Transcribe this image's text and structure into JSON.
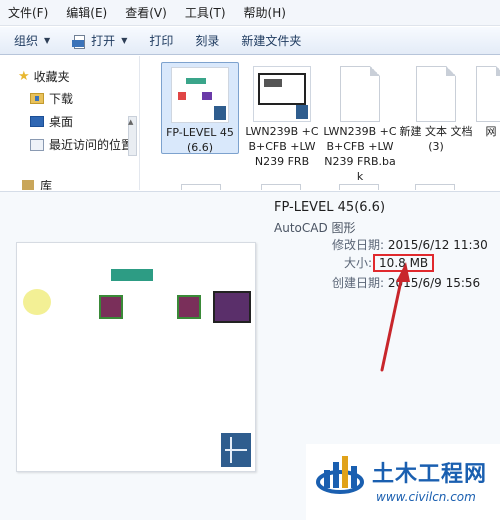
{
  "menubar": {
    "items": [
      "文件(F)",
      "编辑(E)",
      "查看(V)",
      "工具(T)",
      "帮助(H)"
    ]
  },
  "toolbar": {
    "organize": "组织",
    "open": "打开",
    "print": "打印",
    "burn": "刻录",
    "new_folder": "新建文件夹"
  },
  "nav": {
    "favorites": "收藏夹",
    "downloads": "下载",
    "desktop": "桌面",
    "recent": "最近访问的位置",
    "libraries": "库"
  },
  "files": [
    {
      "name": "FP-LEVEL 45(6.6)",
      "icon": "dwg-file-icon",
      "selected": true
    },
    {
      "name": "LWN239B +CB+CFB +LWN239 FRB",
      "icon": "dwg-file-icon"
    },
    {
      "name": "LWN239B +CB+CFB +LWN239 FRB.bak",
      "icon": "blank-file-icon"
    },
    {
      "name": "新建 文本 文档 (3)",
      "icon": "text-file-icon"
    },
    {
      "name": "网",
      "icon": "blank-file-icon"
    }
  ],
  "details": {
    "file_name": "FP-LEVEL 45(6.6)",
    "file_type": "AutoCAD 图形",
    "modified_label": "修改日期:",
    "modified_value": "2015/6/12 11:30",
    "size_label": "大小:",
    "size_value": "10.8 MB",
    "created_label": "创建日期:",
    "created_value": "2015/6/9 15:56"
  },
  "watermark": {
    "title": "土木工程网",
    "url": "www.civilcn.com"
  },
  "colors": {
    "highlight_red": "#e0292d",
    "selection_blue": "#d9e8fb",
    "brand_blue": "#1a5fb0"
  }
}
